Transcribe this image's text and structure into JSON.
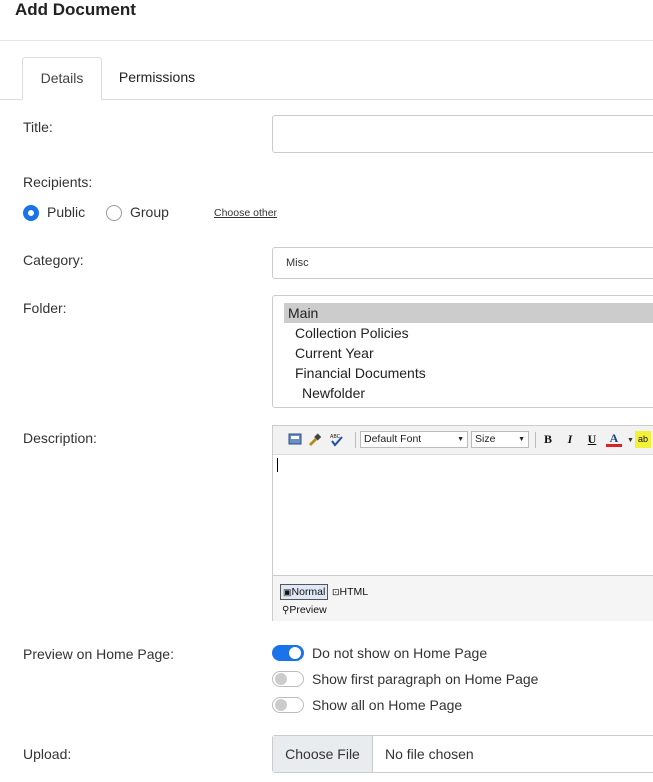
{
  "header": {
    "title": "Add Document"
  },
  "tabs": [
    {
      "label": "Details"
    },
    {
      "label": "Permissions"
    }
  ],
  "form": {
    "title_label": "Title:",
    "title_value": "",
    "recipients_label": "Recipients:",
    "recipients": [
      {
        "label": "Public",
        "selected": true
      },
      {
        "label": "Group",
        "selected": false
      }
    ],
    "choose_other_label": "Choose other",
    "category_label": "Category:",
    "category_value": "Misc",
    "folder_label": "Folder:",
    "folders": [
      {
        "label": "Main",
        "selected": true,
        "indent": 0
      },
      {
        "label": "Collection Policies",
        "selected": false,
        "indent": 1
      },
      {
        "label": "Current Year",
        "selected": false,
        "indent": 1
      },
      {
        "label": "Financial Documents",
        "selected": false,
        "indent": 1
      },
      {
        "label": "Newfolder",
        "selected": false,
        "indent": 2
      }
    ],
    "description_label": "Description:",
    "editor": {
      "font_select": "Default Font",
      "size_select": "Size",
      "bold": "B",
      "italic": "I",
      "underline": "U",
      "font_color": "A",
      "highlight": "ab",
      "modes": [
        "Normal",
        "HTML",
        "Preview"
      ]
    },
    "preview_label": "Preview on Home Page:",
    "preview_options": [
      {
        "label": "Do not show on Home Page",
        "on": true
      },
      {
        "label": "Show first paragraph on Home Page",
        "on": false
      },
      {
        "label": "Show all on Home Page",
        "on": false
      }
    ],
    "upload_label": "Upload:",
    "upload_button": "Choose File",
    "upload_status": "No file chosen"
  },
  "colors": {
    "accent": "#1a73e8",
    "selected_folder": "#cccccc"
  }
}
